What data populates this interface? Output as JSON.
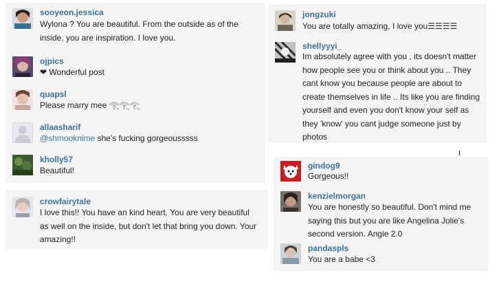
{
  "panels": {
    "left_top": {
      "comments": [
        {
          "username": "sooyeon.jessica",
          "text": "Wylona ? You are beautiful. From the outside as of the inside, you are inspiration. I love you.",
          "avatar": "user-avatar-photo"
        },
        {
          "username": "ojpics",
          "heart": "❤",
          "text": "Wonderful post",
          "avatar": "user-avatar-photo"
        },
        {
          "username": "quapsl",
          "text": "Please marry mee 𓂀𓂀𓂀",
          "avatar": "user-avatar-photo"
        },
        {
          "username": "allaasharif",
          "mention": "@shmooknime",
          "text": "she's fucking gorgeousssss",
          "avatar": "default-avatar-silhouette"
        },
        {
          "username": "kholly57",
          "text": "Beautiful!",
          "avatar": "user-avatar-photo"
        }
      ]
    },
    "left_bottom": {
      "comments": [
        {
          "username": "crowfairytale",
          "text": "I love this!! You have an kind heart. You are very beautiful as well on the inside, but don't let that bring you down. Your amazing!!",
          "avatar": "user-avatar-photo"
        }
      ]
    },
    "right_top": {
      "comments": [
        {
          "username": "jongzuki",
          "text": "You are totally amazing, I love you☰☰☰☰",
          "avatar": "user-avatar-photo"
        },
        {
          "username": "shellyyyi_",
          "text": "Im absolutely agree with you , its doesn't matter how people see you or think about you .. They cant know you because people are about to create themselves in life .. Its like you are finding yourself and even you don't know your self as they 'know' you cant judge someone just by photos",
          "avatar": "user-avatar-photo"
        }
      ]
    },
    "right_bottom": {
      "comments": [
        {
          "username": "gindog9",
          "text": "Gorgeous!!",
          "avatar": "user-avatar-photo"
        },
        {
          "username": "kenzielmorgan",
          "text": "You are honestly so beautiful. Don't mind me saying this but you are like Angelina Jolie's second version. Angie 2.0",
          "avatar": "user-avatar-photo"
        },
        {
          "username": "pandaspls",
          "text": "You are a babe <3",
          "avatar": "user-avatar-photo"
        }
      ]
    }
  }
}
